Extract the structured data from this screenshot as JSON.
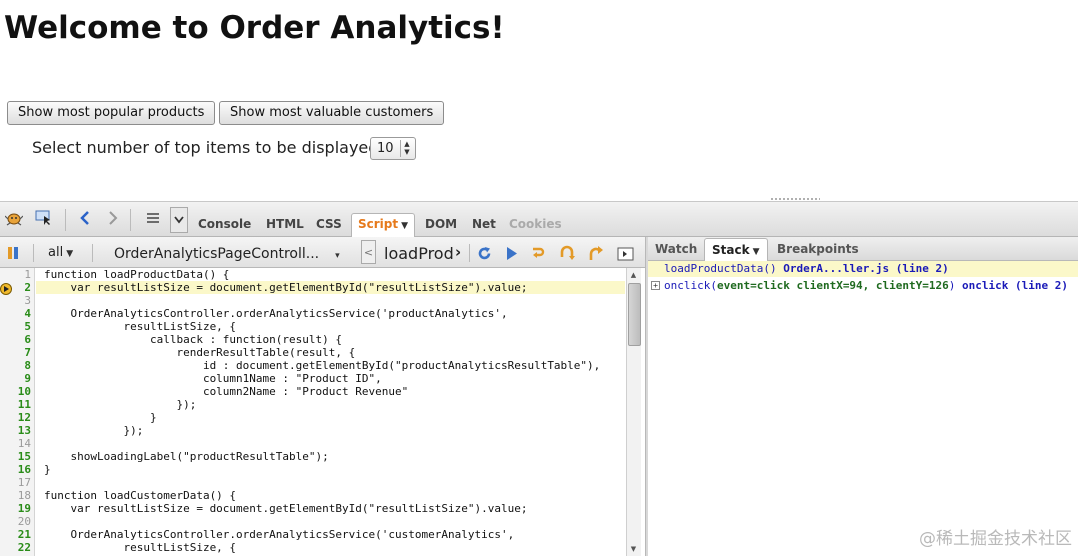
{
  "page": {
    "title": "Welcome to Order Analytics!",
    "buttons": [
      "Show most popular products",
      "Show most valuable customers"
    ],
    "select_label": "Select number of top items to be displayed",
    "select_value": "10"
  },
  "firebug": {
    "tabs": [
      "Console",
      "HTML",
      "CSS",
      "Script",
      "DOM",
      "Net",
      "Cookies"
    ],
    "active_tab": "Script",
    "disabled_tabs": [
      "Cookies"
    ],
    "icons": [
      "firebug-icon",
      "inspect-icon",
      "back-icon",
      "forward-icon",
      "menu-icon",
      "dropdown-icon"
    ]
  },
  "script_toolbar": {
    "filter": "all",
    "file": "OrderAnalyticsPageControll...",
    "function": "loadProd",
    "icons": [
      "pause-icon",
      "rerun-icon",
      "continue-icon",
      "step-over-icon",
      "step-into-icon",
      "step-out-icon",
      "toggle-panel-icon"
    ]
  },
  "code": {
    "current_line": 2,
    "exec_lines": [
      2,
      4,
      5,
      6,
      7,
      8,
      9,
      10,
      11,
      12,
      13,
      15,
      16,
      19,
      21,
      22
    ],
    "lines": [
      "function loadProductData() {",
      "    var resultListSize = document.getElementById(\"resultListSize\").value;",
      "",
      "    OrderAnalyticsController.orderAnalyticsService('productAnalytics',",
      "            resultListSize, {",
      "                callback : function(result) {",
      "                    renderResultTable(result, {",
      "                        id : document.getElementById(\"productAnalyticsResultTable\"),",
      "                        column1Name : \"Product ID\",",
      "                        column2Name : \"Product Revenue\"",
      "                    });",
      "                }",
      "            });",
      "",
      "    showLoadingLabel(\"productResultTable\");",
      "}",
      "",
      "function loadCustomerData() {",
      "    var resultListSize = document.getElementById(\"resultListSize\").value;",
      "",
      "    OrderAnalyticsController.orderAnalyticsService('customerAnalytics',",
      "            resultListSize, {"
    ]
  },
  "side_panel": {
    "tabs": [
      "Watch",
      "Stack",
      "Breakpoints"
    ],
    "active_tab": "Stack",
    "stack": [
      {
        "fn": "loadProductData()",
        "src": "OrderA...ller.js (line 2)"
      },
      {
        "fn": "onclick(",
        "args": "event=click clientX=94, clientY=126",
        "close": ")",
        "src": "onclick (line 2)"
      }
    ]
  },
  "watermark": "@稀土掘金技术社区",
  "colors": {
    "active_tab": "#e67a1c",
    "current_line_bg": "#fbf8c9",
    "exec_line_number": "#2a8c19",
    "stack_fn": "#1a1ab8"
  }
}
